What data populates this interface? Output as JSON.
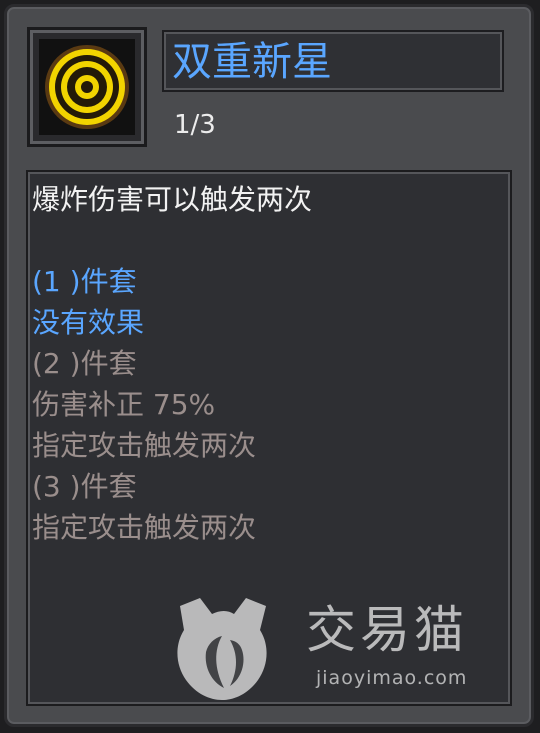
{
  "item": {
    "name": "双重新星",
    "count": "1/3",
    "icon": "concentric-rings-icon",
    "description": "爆炸伤害可以触发两次"
  },
  "set_bonuses": [
    {
      "label": "(1 )件套",
      "effect": "没有效果",
      "active": true
    },
    {
      "label": "(2 )件套",
      "effect": "伤害补正 75%",
      "effect2": "指定攻击触发两次",
      "active": false
    },
    {
      "label": "(3 )件套",
      "effect": "指定攻击触发两次",
      "active": false
    }
  ],
  "watermark": {
    "brand": "交易猫",
    "url": "jiaoyimao.com",
    "icon": "cat-logo-icon"
  },
  "colors": {
    "active_text": "#5aa6ff",
    "inactive_text": "#9a8e8c",
    "description_text": "#f2f2f2",
    "icon_gold": "#f2d400"
  }
}
